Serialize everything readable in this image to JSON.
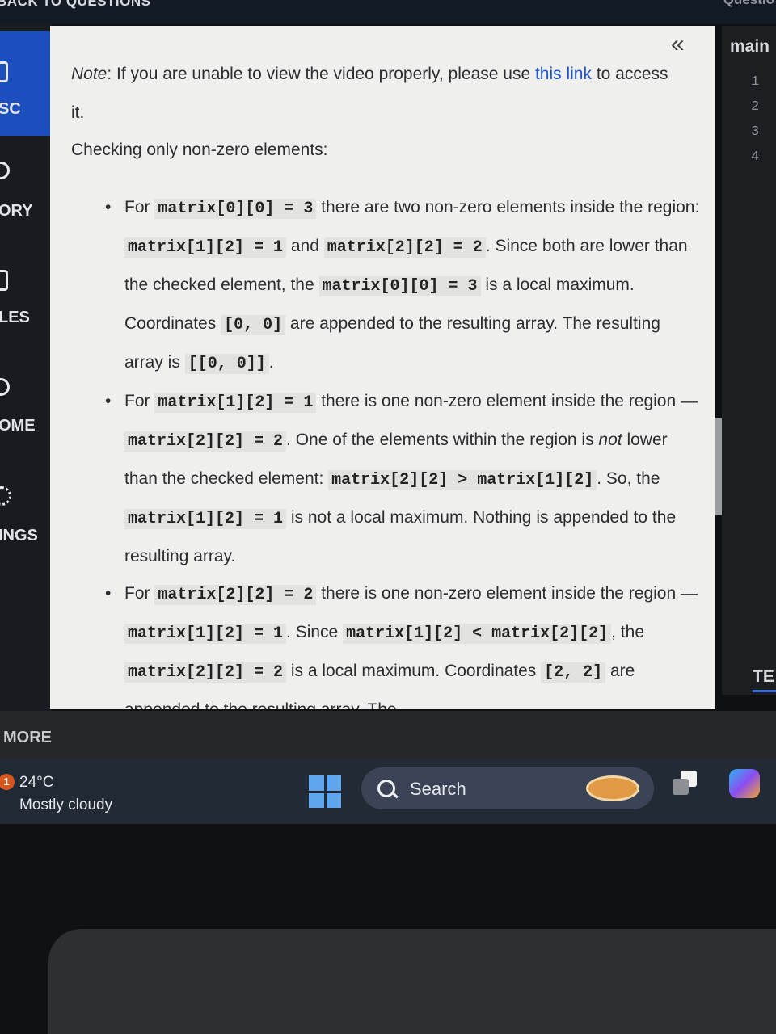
{
  "topbar": {
    "back_label": "BACK TO QUESTIONS",
    "right_label": "Questio"
  },
  "sidebar": {
    "items": [
      {
        "label": "SC",
        "icon": "document-icon"
      },
      {
        "label": "ORY",
        "icon": "history-icon"
      },
      {
        "label": "LES",
        "icon": "modules-icon"
      },
      {
        "label": "OME",
        "icon": "home-icon"
      },
      {
        "label": "INGS",
        "icon": "gear-icon"
      }
    ]
  },
  "content": {
    "collapse_label": "«",
    "note_prefix": "Note",
    "note_text": ": If you are unable to view the video properly, please use ",
    "note_link": "this link",
    "note_suffix": " to access it.",
    "intro": "Checking only non-zero elements:",
    "bullets": [
      {
        "t1": "For ",
        "c1": "matrix[0][0] = 3",
        "t2": " there are two non-zero elements inside the region: ",
        "c2": "matrix[1][2] = 1",
        "t3": " and ",
        "c3": "matrix[2][2] = 2",
        "t4": ". Since both are lower than the checked element, the ",
        "c4": "matrix[0][0] = 3",
        "t5": " is a local maximum. Coordinates ",
        "c5": "[0, 0]",
        "t6": " are appended to the resulting array. The resulting array is ",
        "c6": "[[0, 0]]",
        "t7": "."
      },
      {
        "t1": "For ",
        "c1": "matrix[1][2] = 1",
        "t2": " there is one non-zero element inside the region — ",
        "c2": "matrix[2][2] = 2",
        "t3": ". One of the elements within the region is ",
        "em": "not",
        "t4": " lower than the checked element: ",
        "c3": "matrix[2][2] > matrix[1][2]",
        "t5": ". So, the ",
        "c4": "matrix[1][2] = 1",
        "t6": " is not a local maximum. Nothing is appended to the resulting array."
      },
      {
        "t1": "For ",
        "c1": "matrix[2][2] = 2",
        "t2": " there is one non-zero element inside the region — ",
        "c2": "matrix[1][2] = 1",
        "t3": ". Since ",
        "c3": "matrix[1][2] < matrix[2][2]",
        "t4": ", the ",
        "c4": "matrix[2][2] = 2",
        "t5": " is a local maximum. Coordinates ",
        "c5": "[2, 2]",
        "t6": " are appended to the resulting array. The"
      }
    ]
  },
  "right_panel": {
    "label": "main",
    "line_numbers": [
      "1",
      "2",
      "3",
      "4"
    ],
    "tab_label": "TE"
  },
  "more_label": "MORE",
  "taskbar": {
    "weather_badge": "1",
    "temperature": "24°C",
    "weather": "Mostly cloudy",
    "search_label": "Search"
  },
  "colors": {
    "link": "#1e55c8",
    "sidebar_active": "#1b4fbd",
    "panel_bg": "#efefed",
    "taskbar": "#222a36"
  }
}
